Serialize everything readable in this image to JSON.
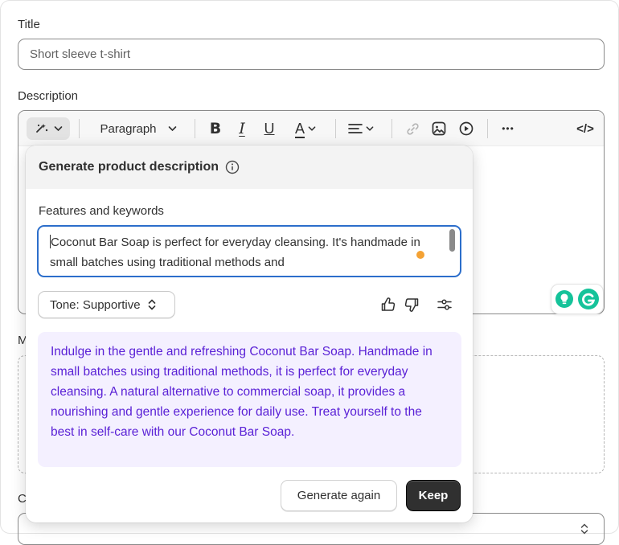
{
  "fields": {
    "title_label": "Title",
    "title_value": "Short sleeve t-shirt",
    "description_label": "Description"
  },
  "toolbar": {
    "paragraph_label": "Paragraph",
    "more_label": "•••",
    "html_label": "</>"
  },
  "side_chars": {
    "m": "M",
    "c": "C"
  },
  "popover": {
    "title": "Generate product description",
    "features_label": "Features and keywords",
    "features_text": "Coconut Bar Soap is perfect for everyday cleansing. It's handmade in small batches using traditional methods and",
    "tone_label": "Tone: Supportive",
    "result_text": "Indulge in the gentle and refreshing Coconut Bar Soap. Handmade in small batches using traditional methods, it is perfect for everyday cleansing. A natural alternative to commercial soap, it provides a nourishing and gentle experience for daily use. Treat yourself to the best in self-care with our Coconut Bar Soap.",
    "generate_again_label": "Generate again",
    "keep_label": "Keep"
  },
  "colors": {
    "accent_focus": "#2c6ecb",
    "result_text": "#5a21d6",
    "result_bg": "#f4f0ff",
    "primary_button": "#303030",
    "grammarly_green": "#15c39a"
  },
  "icons": [
    "magic-icon",
    "chevron-down-icon",
    "bold-icon",
    "italic-icon",
    "underline-icon",
    "text-color-icon",
    "align-icon",
    "link-icon",
    "image-icon",
    "video-icon",
    "more-icon",
    "code-icon",
    "info-icon",
    "up-down-icon",
    "thumbs-up-icon",
    "thumbs-down-icon",
    "settings-sliders-icon",
    "grammarly-icon",
    "lightbulb-icon"
  ]
}
